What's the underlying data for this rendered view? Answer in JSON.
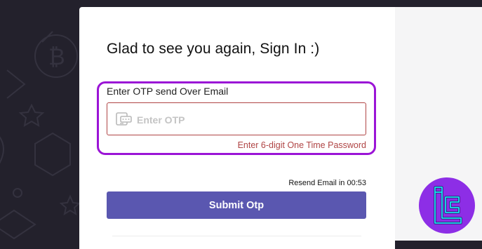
{
  "page": {
    "title": "Glad to see you again, Sign In :)"
  },
  "otp": {
    "label": "Enter OTP send Over Email",
    "placeholder": "Enter OTP",
    "value": "",
    "error": "Enter 6-digit One Time Password",
    "icon": "otp-device-icon"
  },
  "resend": {
    "text": "Resend Email in 00:53"
  },
  "submit": {
    "label": "Submit Otp"
  },
  "colors": {
    "accent": "#5a57b0",
    "highlight": "#9b14d6",
    "error": "#b04545",
    "background": "#23212c",
    "logo": "#8d2ee6"
  },
  "logo": {
    "icon": "tc-logo-icon"
  }
}
